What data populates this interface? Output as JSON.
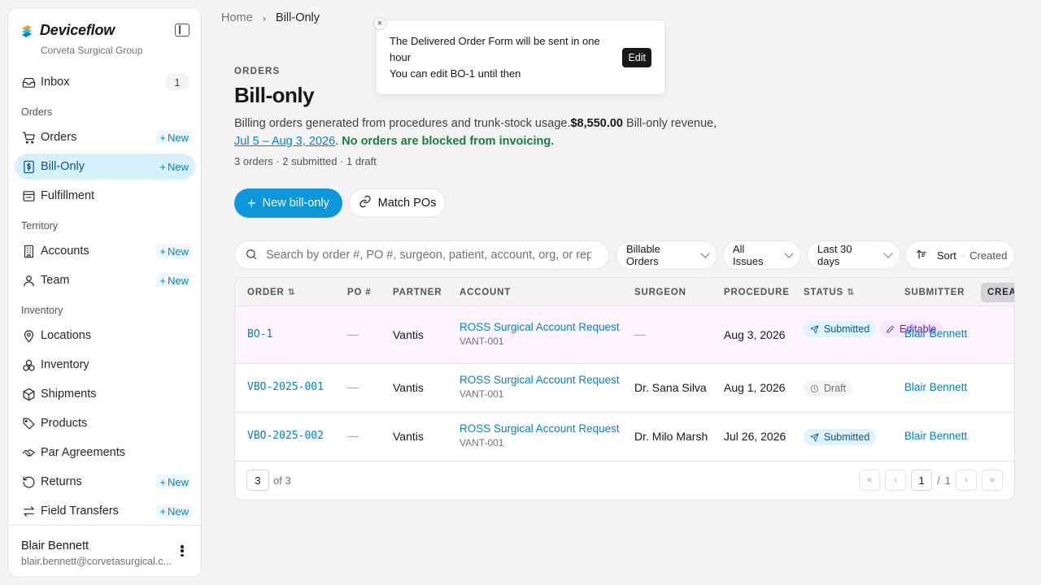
{
  "app": {
    "name": "Deviceflow",
    "org": "Corveta Surgical Group",
    "accent": "#0d97db"
  },
  "sidebar": {
    "inbox": {
      "label": "Inbox",
      "count": "1"
    },
    "sections": {
      "orders": "Orders",
      "territory": "Territory",
      "inventory": "Inventory"
    },
    "new_label": "New",
    "items": {
      "orders": "Orders",
      "bill_only": "Bill-Only",
      "fulfillment": "Fulfillment",
      "accounts": "Accounts",
      "team": "Team",
      "locations": "Locations",
      "inventory": "Inventory",
      "shipments": "Shipments",
      "products": "Products",
      "par_agreements": "Par Agreements",
      "returns": "Returns",
      "field_transfers": "Field Transfers"
    },
    "user": {
      "name": "Blair Bennett",
      "email": "blair.bennett@corvetasurgical.c..."
    }
  },
  "breadcrumb": {
    "home": "Home",
    "current": "Bill-Only"
  },
  "toast": {
    "line1": "The Delivered Order Form will be sent in one hour",
    "line2": "You can edit BO-1 until then",
    "edit_label": "Edit"
  },
  "page": {
    "eyebrow": "ORDERS",
    "title": "Bill-only",
    "desc_prefix": "Billing orders generated from procedures and trunk-stock usage.",
    "revenue": "$8,550.00",
    "desc_revenue_suffix": " Bill-only revenue,",
    "range": "Jul 5 – Aug 3, 2026",
    "range_suffix": ".",
    "status_ok": "No orders are blocked from invoicing.",
    "summary": "3 orders · 2 submitted · 1 draft",
    "new_button": "New bill-only",
    "match_button": "Match POs"
  },
  "filters": {
    "search_placeholder": "Search by order #, PO #, surgeon, patient, account, org, or rep...",
    "billable": "Billable Orders",
    "issues": "All Issues",
    "period": "Last 30 days",
    "sort_label": "Sort",
    "sort_sep": "·",
    "sort_field": "Created"
  },
  "table": {
    "headers": {
      "order": "ORDER",
      "po": "PO #",
      "partner": "PARTNER",
      "account": "ACCOUNT",
      "surgeon": "SURGEON",
      "procedure": "PROCEDURE",
      "status": "STATUS",
      "submitter": "SUBMITTER",
      "created": "CREATED"
    },
    "rows": [
      {
        "order": "BO-1",
        "po": "—",
        "partner": "Vantis",
        "account": "ROSS Surgical Account Request",
        "account_code": "VANT-001",
        "surgeon": "—",
        "procedure": "Aug 3, 2026",
        "status": "Submitted",
        "status2": "Editable",
        "submitter": "Blair Bennett"
      },
      {
        "order": "VBO-2025-001",
        "po": "—",
        "partner": "Vantis",
        "account": "ROSS Surgical Account Request",
        "account_code": "VANT-001",
        "surgeon": "Dr. Sana Silva",
        "procedure": "Aug 1, 2026",
        "status": "Draft",
        "submitter": "Blair Bennett"
      },
      {
        "order": "VBO-2025-002",
        "po": "—",
        "partner": "Vantis",
        "account": "ROSS Surgical Account Request",
        "account_code": "VANT-001",
        "surgeon": "Dr. Milo Marsh",
        "procedure": "Jul 26, 2026",
        "status": "Submitted",
        "submitter": "Blair Bennett"
      }
    ],
    "footer": {
      "page_size": "3",
      "of_total": "of 3",
      "page": "1",
      "page_sep": "/",
      "pages": "1"
    }
  }
}
